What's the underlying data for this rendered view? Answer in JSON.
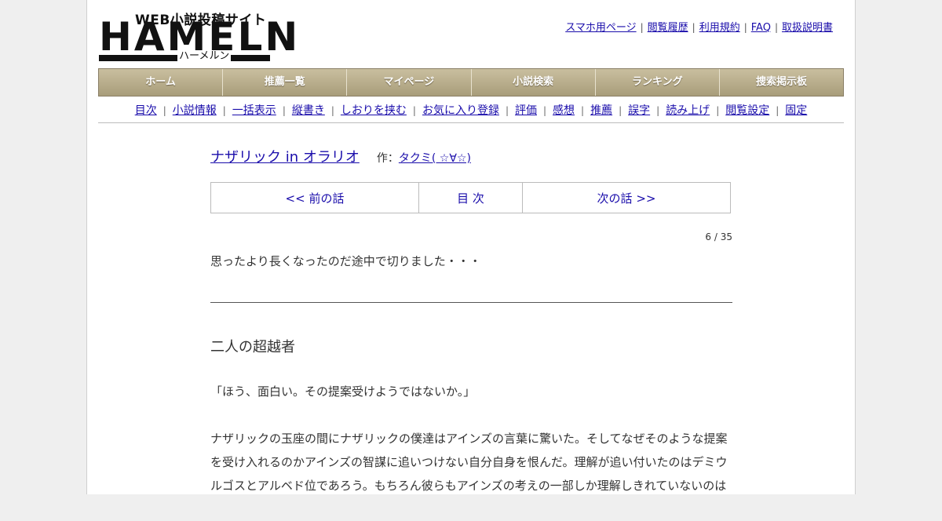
{
  "header": {
    "logo_sub": "WEB小説投稿サイト",
    "logo_main": "HAMELN",
    "logo_kana": "ハーメルン",
    "links": [
      "スマホ用ページ",
      "閲覧履歴",
      "利用規約",
      "FAQ",
      "取扱説明書"
    ]
  },
  "nav": [
    "ホーム",
    "推薦一覧",
    "マイページ",
    "小説検索",
    "ランキング",
    "捜索掲示板"
  ],
  "submenu": [
    "目次",
    "小説情報",
    "一括表示",
    "縦書き",
    "しおりを挟む",
    "お気に入り登録",
    "評価",
    "感想",
    "推薦",
    "誤字",
    "読み上げ",
    "閲覧設定",
    "固定"
  ],
  "novel": {
    "title": "ナザリック in オラリオ",
    "author_prefix": "作：",
    "author": "タクミ( ☆∀☆)"
  },
  "pager": {
    "prev": "<< 前の話",
    "toc": "目 次",
    "next": "次の話 >>"
  },
  "chapter": {
    "count": "6 / 35",
    "preface": "思ったより長くなったのだ途中で切りました・・・",
    "title": "二人の超越者",
    "paragraphs": [
      "「ほう、面白い。その提案受けようではないか。」",
      "ナザリックの玉座の間にナザリックの僕達はアインズの言葉に驚いた。そしてなぜそのような提案を受け入れるのかアインズの智謀に追いつけない自分自身を恨んだ。理解が追い付いたのはデミウルゴスとアルベド位であろう。もちろん彼らもアインズの考えの一部しか理解しきれていないのは"
    ]
  }
}
